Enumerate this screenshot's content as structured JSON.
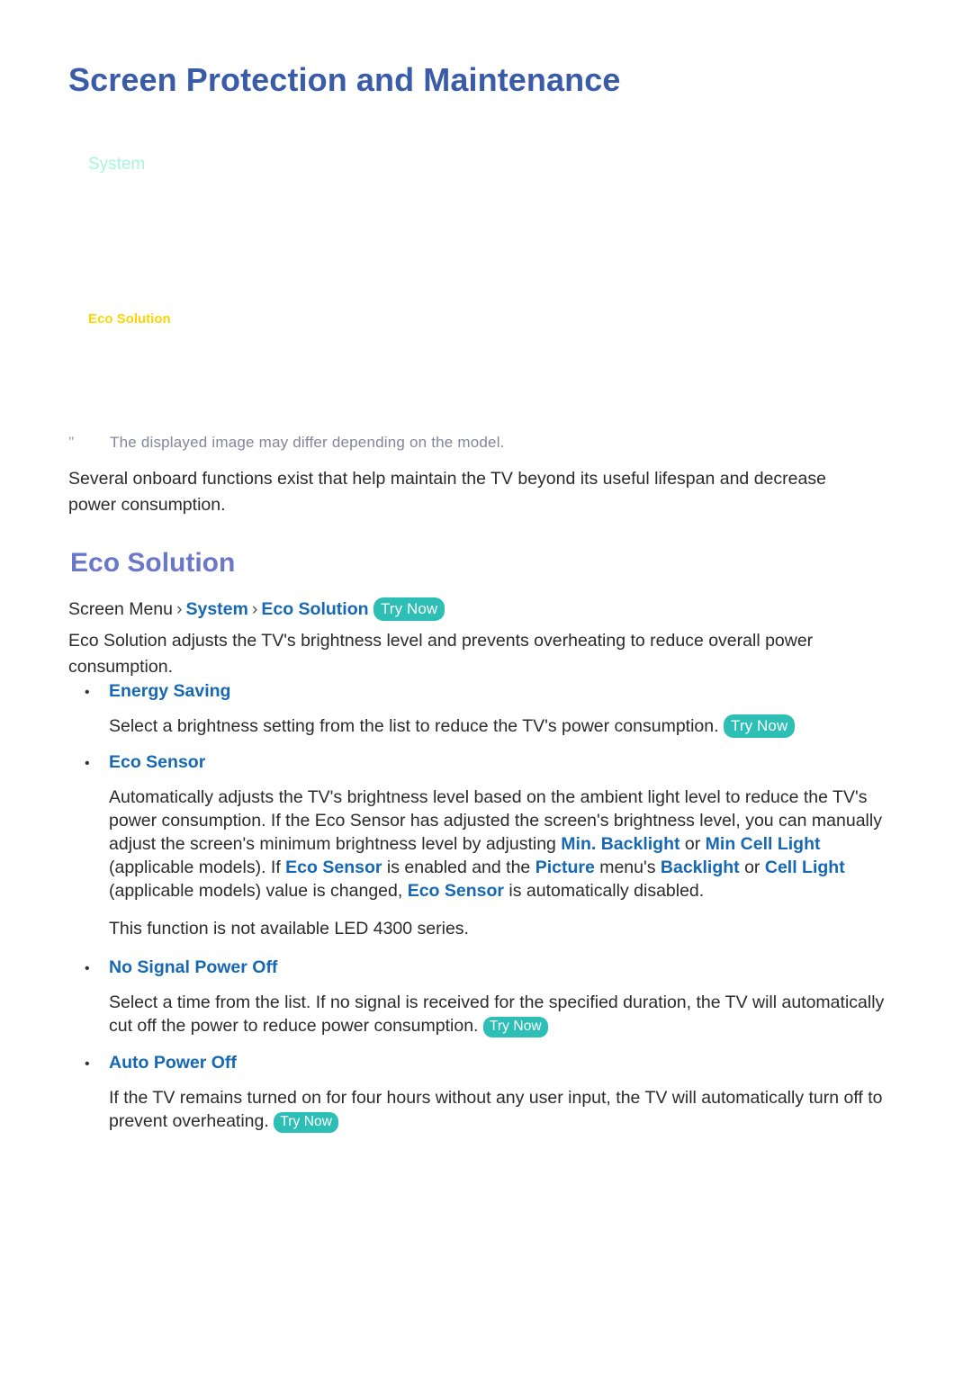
{
  "page": {
    "title": "Screen Protection and Maintenance"
  },
  "menu_illustration": {
    "system_label": "System",
    "eco_solution_label": "Eco Solution"
  },
  "note": {
    "marker": "\"",
    "text": "The displayed image may differ depending on the model."
  },
  "intro": {
    "paragraph": "Several onboard functions exist that help maintain the TV beyond its useful lifespan and decrease power consumption."
  },
  "section": {
    "heading": "Eco Solution",
    "breadcrumb": {
      "prefix": "Screen Menu",
      "separator": "›",
      "item1": "System",
      "item2": "Eco Solution",
      "try_now": "Try Now"
    },
    "lead": "Eco Solution adjusts the TV's brightness level and prevents overheating to reduce overall power consumption."
  },
  "bullets": {
    "bullet_char": "•",
    "energy_saving": {
      "label": "Energy Saving",
      "body_1": "Select a brightness setting from the list to reduce the TV's power consumption.",
      "try_now": "Try Now"
    },
    "eco_sensor": {
      "label": "Eco Sensor",
      "body_1": "Automatically adjusts the TV's brightness level based on the ambient light level to reduce the TV's power consumption. If the Eco Sensor has adjusted the screen's brightness level, you can manually adjust the screen's minimum brightness level by adjusting ",
      "kw_1": "Min. Backlight",
      "body_2": " or ",
      "kw_2": "Min Cell Light",
      "body_3": " (applicable models). If ",
      "kw_3": "Eco Sensor",
      "body_4": " is enabled and the ",
      "kw_4": "Picture",
      "body_5": " menu's ",
      "kw_5": "Backlight",
      "body_6": " or ",
      "kw_6": "Cell Light",
      "body_7": " (applicable models) value is changed, ",
      "kw_7": "Eco Sensor",
      "body_8": " is automatically disabled.",
      "note": "This function is not available LED 4300 series."
    },
    "no_signal_power_off": {
      "label": "No Signal Power Off",
      "body_1": "Select a time from the list. If no signal is received for the specified duration, the TV will automatically cut off the power to reduce power consumption.",
      "try_now": "Try Now"
    },
    "auto_power_off": {
      "label": "Auto Power Off",
      "body_1": "If the TV remains turned on for four hours without any user input, the TV will automatically turn off to prevent overheating.",
      "try_now": "Try Now"
    }
  },
  "colors": {
    "title_blue": "#3a5ba8",
    "heading_blue": "#6b77c8",
    "link_blue": "#1668b3",
    "try_now_teal": "#2dbfb5",
    "note_gray": "#84849b",
    "illus_system_mint": "#a8f5dd",
    "illus_eco_yellow": "#ffd400"
  }
}
